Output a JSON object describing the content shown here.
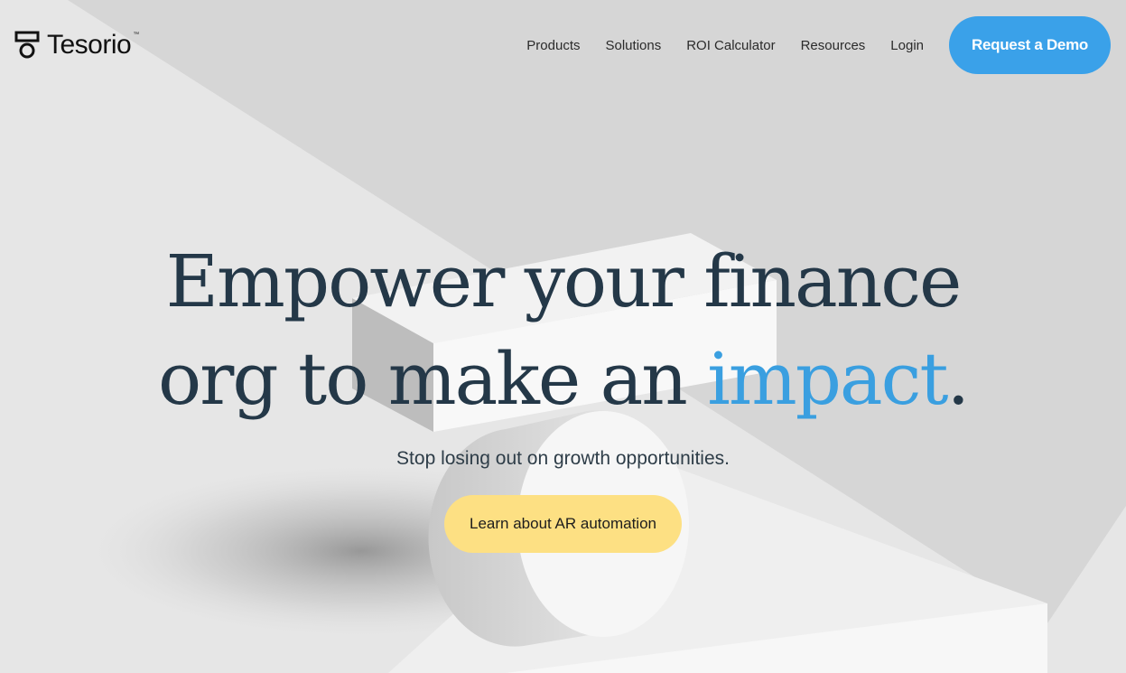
{
  "brand": {
    "name": "Tesorio",
    "trademark": "™",
    "logo_icon": "tesorio-logo-mark"
  },
  "nav": {
    "links": [
      {
        "label": "Products"
      },
      {
        "label": "Solutions"
      },
      {
        "label": "ROI Calculator"
      },
      {
        "label": "Resources"
      },
      {
        "label": "Login"
      }
    ],
    "cta_label": "Request a Demo"
  },
  "hero": {
    "headline_line1": "Empower your finance",
    "headline_line2_prefix": "org to make an ",
    "headline_accent": "impact",
    "headline_suffix": ".",
    "subtitle": "Stop losing out on growth opportunities.",
    "cta_label": "Learn about AR automation"
  },
  "colors": {
    "primary_blue": "#3aa1e9",
    "accent_blue": "#3a9fe0",
    "cta_yellow": "#fde083",
    "headline_navy": "#243848",
    "background_gray": "#e4e4e4"
  }
}
